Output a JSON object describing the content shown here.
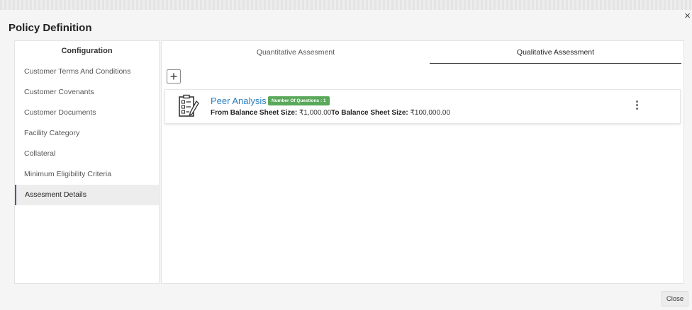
{
  "window": {
    "title": "Policy Definition",
    "close_glyph": "×"
  },
  "sidebar": {
    "header": "Configuration",
    "items": [
      {
        "label": "Customer Terms And Conditions"
      },
      {
        "label": "Customer Covenants"
      },
      {
        "label": "Customer Documents"
      },
      {
        "label": "Facility Category"
      },
      {
        "label": "Collateral"
      },
      {
        "label": "Minimum Eligibility Criteria"
      },
      {
        "label": "Assesment Details",
        "active": true
      }
    ]
  },
  "tabs": [
    {
      "label": "Quantitative Assesment",
      "active": false
    },
    {
      "label": "Qualitative Assessment",
      "active": true
    }
  ],
  "add_button": {
    "glyph": "+"
  },
  "card": {
    "icon": "checklist-clipboard-icon",
    "name": "Peer Analysis",
    "badge": "Number Of Questions : 1",
    "from_label": "From Balance Sheet Size:",
    "from_value": "₹1,000.00",
    "to_label": "To Balance Sheet Size:",
    "to_value": "₹100,000.00",
    "menu_glyph": "⋮"
  },
  "footer": {
    "close_label": "Close"
  },
  "colors": {
    "link": "#2a7fc1",
    "badge": "#5aa85a",
    "active_border": "#4a5b85"
  }
}
